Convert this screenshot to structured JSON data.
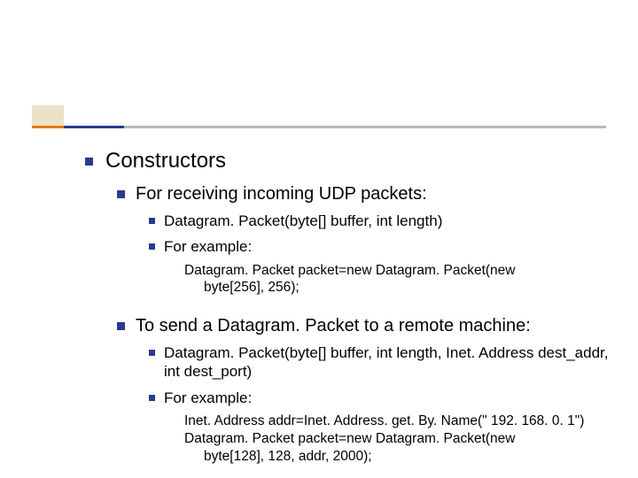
{
  "heading": "Constructors",
  "sections": [
    {
      "title": "For receiving incoming UDP packets:",
      "items": [
        "Datagram. Packet(byte[] buffer, int length)",
        "For example:"
      ],
      "code": [
        "Datagram. Packet packet=new Datagram. Packet(new",
        "byte[256], 256);"
      ]
    },
    {
      "title": "To send a Datagram. Packet to a remote machine:",
      "items": [
        "Datagram. Packet(byte[] buffer, int length, Inet. Address dest_addr, int dest_port)",
        "For example:"
      ],
      "code": [
        "Inet. Address addr=Inet. Address. get. By. Name(\" 192. 168. 0. 1\")",
        "Datagram. Packet packet=new Datagram. Packet(new",
        "byte[128], 128, addr, 2000);"
      ]
    }
  ]
}
